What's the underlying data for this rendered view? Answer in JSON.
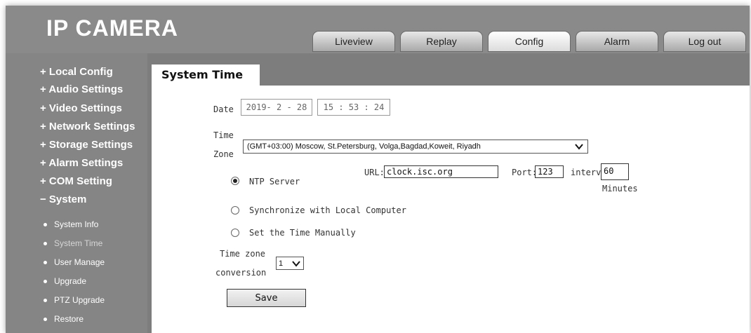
{
  "app": {
    "title": "IP CAMERA"
  },
  "nav": {
    "tabs": [
      {
        "label": "Liveview"
      },
      {
        "label": "Replay"
      },
      {
        "label": "Config"
      },
      {
        "label": "Alarm"
      },
      {
        "label": "Log out"
      }
    ],
    "active_tab": "Config"
  },
  "sidebar": {
    "groups": [
      {
        "label": "+ Local Config"
      },
      {
        "label": "+ Audio Settings"
      },
      {
        "label": "+ Video Settings"
      },
      {
        "label": "+ Network Settings"
      },
      {
        "label": "+ Storage Settings"
      },
      {
        "label": "+ Alarm Settings"
      },
      {
        "label": "+ COM Setting"
      },
      {
        "label": "− System"
      }
    ],
    "sub_items": [
      {
        "label": "System Info"
      },
      {
        "label": "System Time"
      },
      {
        "label": "User Manage"
      },
      {
        "label": "Upgrade"
      },
      {
        "label": "PTZ Upgrade"
      },
      {
        "label": "Restore"
      }
    ],
    "active_sub": "System Time"
  },
  "page": {
    "tab_title": "System Time",
    "date": {
      "label": "Date",
      "date_value": "2019- 2 - 28",
      "time_value": "15 : 53 : 24"
    },
    "time_zone": {
      "label_line1": "Time",
      "label_line2": "Zone",
      "selected": "(GMT+03:00) Moscow, St.Petersburg, Volga,Bagdad,Koweit, Riyadh"
    },
    "sync_options": [
      {
        "label": "NTP Server",
        "selected": true
      },
      {
        "label": "Synchronize with Local Computer",
        "selected": false
      },
      {
        "label": "Set the Time Manually",
        "selected": false
      }
    ],
    "ntp": {
      "url_label": "URL:",
      "url_value": "clock.isc.org",
      "port_label": "Port:",
      "port_value": "123",
      "interval_label": "interval",
      "interval_value": "60",
      "interval_unit": "Minutes"
    },
    "tz_conversion": {
      "label_line1": "Time zone",
      "label_line2": "conversion",
      "selected": "1"
    },
    "save_label": "Save"
  }
}
